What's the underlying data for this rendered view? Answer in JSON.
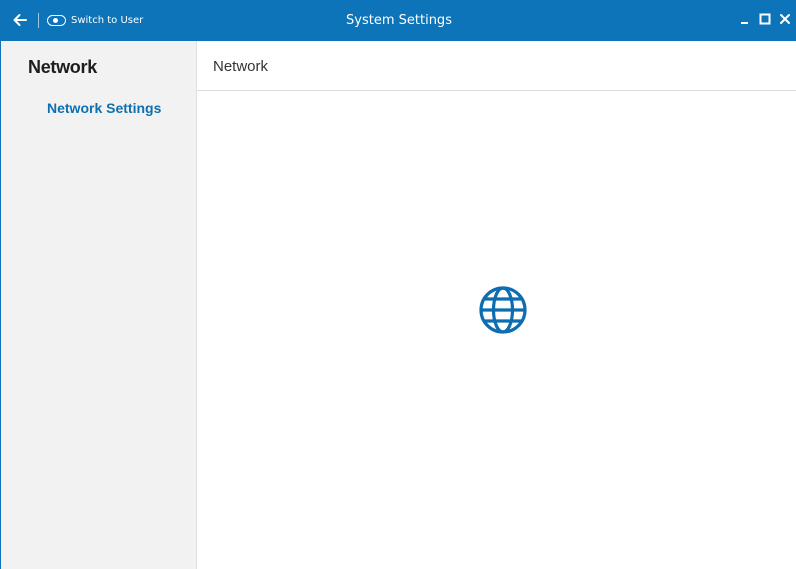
{
  "titlebar": {
    "title": "System Settings",
    "switch_label": "Switch to User",
    "icons": {
      "back": "back-arrow-icon",
      "toggle": "toggle-icon",
      "minimize": "minimize-icon",
      "maximize": "maximize-icon",
      "close": "close-icon"
    }
  },
  "sidebar": {
    "heading": "Network",
    "items": [
      {
        "label": "Network Settings"
      }
    ]
  },
  "content": {
    "title": "Network",
    "icon": "globe-icon"
  },
  "colors": {
    "accent": "#0d74b9",
    "sidebar_background": "#f2f2f2",
    "link": "#0e70b0"
  }
}
